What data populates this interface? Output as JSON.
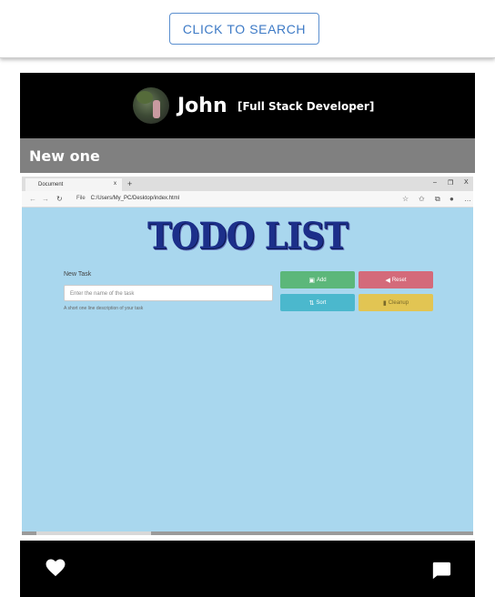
{
  "header": {
    "search_button": "CLICK TO SEARCH"
  },
  "post": {
    "author": {
      "name": "John",
      "role": "[Full Stack Developer]"
    },
    "title": "New one",
    "screenshot": {
      "browser": {
        "tab_title": "Document",
        "url_prefix": "File",
        "url": "C:/Users/My_PC/Desktop/index.html"
      },
      "app": {
        "heading": "TODO LIST",
        "new_task_label": "New Task",
        "task_input_placeholder": "Enter the name of the task",
        "help_text": "A short one line description of your task",
        "buttons": {
          "add": "Add",
          "reset": "Reset",
          "sort": "Sort",
          "cleanup": "Cleanup"
        }
      }
    },
    "actions": {
      "like_icon": "heart-icon",
      "comment_icon": "comment-icon"
    }
  },
  "colors": {
    "search_accent": "#3d7ac6",
    "card_bg": "#000000",
    "title_bar": "#808080",
    "todo_bg": "#a9d7ee"
  }
}
